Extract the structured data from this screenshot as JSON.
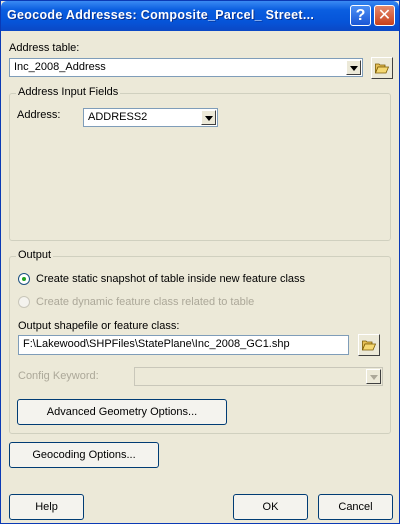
{
  "window": {
    "title": "Geocode Addresses:  Composite_Parcel_ Street...",
    "help_glyph": "?",
    "close_glyph": "✕"
  },
  "address_table": {
    "label": "Address table:",
    "value": "Inc_2008_Address"
  },
  "address_input_fields": {
    "group_title": "Address Input Fields",
    "address_label": "Address:",
    "address_value": "ADDRESS2"
  },
  "output": {
    "group_title": "Output",
    "option_static": "Create static snapshot of table inside new feature class",
    "option_dynamic": "Create dynamic feature class related to table",
    "selected_option": "static",
    "shapefile_label": "Output shapefile or feature class:",
    "shapefile_value": "F:\\Lakewood\\SHPFiles\\StatePlane\\Inc_2008_GC1.shp",
    "config_label": "Config Keyword:",
    "config_value": "",
    "advanced_button": "Advanced Geometry Options..."
  },
  "geocoding_button": "Geocoding Options...",
  "footer": {
    "help": "Help",
    "ok": "OK",
    "cancel": "Cancel"
  },
  "icons": {
    "browse": "folder-open-icon",
    "dropdown": "chevron-down-icon"
  },
  "colors": {
    "titlebar": "#0654d8",
    "dialog_bg": "#ece9d8",
    "radio_dot": "#21a121"
  }
}
